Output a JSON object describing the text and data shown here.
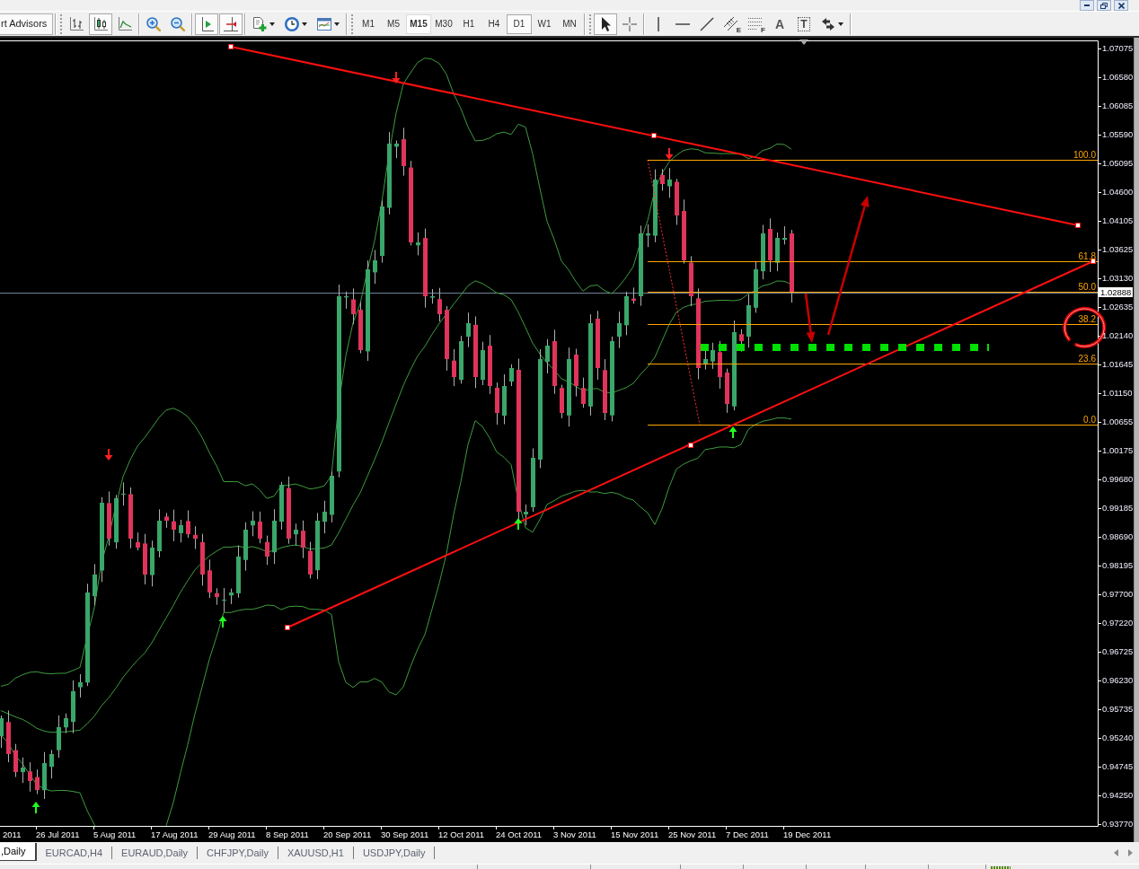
{
  "toolbar": {
    "experts_button": {
      "label": "rt Advisors"
    },
    "chart_tool_groups": [
      [
        {
          "kind": "bar-chart",
          "pressed": false
        },
        {
          "kind": "candlesticks",
          "pressed": true
        },
        {
          "kind": "line-chart",
          "pressed": false
        }
      ],
      [
        {
          "kind": "zoom-in",
          "pressed": false
        },
        {
          "kind": "zoom-out",
          "pressed": false
        }
      ],
      [
        {
          "kind": "chart-shift",
          "pressed": true
        },
        {
          "kind": "auto-scroll",
          "pressed": true
        }
      ],
      [
        {
          "kind": "new-indicator",
          "pressed": false,
          "dropdown": true
        },
        {
          "kind": "periods",
          "pressed": false,
          "dropdown": true
        },
        {
          "kind": "templates",
          "pressed": false,
          "dropdown": true
        }
      ]
    ],
    "timeframes": [
      {
        "label": "M1",
        "selected": false,
        "hovered": false
      },
      {
        "label": "M5",
        "selected": false,
        "hovered": false
      },
      {
        "label": "M15",
        "selected": false,
        "hovered": true
      },
      {
        "label": "M30",
        "selected": false,
        "hovered": false
      },
      {
        "label": "H1",
        "selected": false,
        "hovered": false
      },
      {
        "label": "H4",
        "selected": false,
        "hovered": false
      },
      {
        "label": "D1",
        "selected": true,
        "hovered": false
      },
      {
        "label": "W1",
        "selected": false,
        "hovered": false
      },
      {
        "label": "MN",
        "selected": false,
        "hovered": false
      }
    ],
    "drawing_tool_groups": [
      [
        {
          "kind": "cursor",
          "pressed": true
        },
        {
          "kind": "crosshair",
          "pressed": false
        }
      ],
      [
        {
          "kind": "vertical-line",
          "pressed": false
        },
        {
          "kind": "horizontal-line",
          "pressed": false
        },
        {
          "kind": "trend-line",
          "pressed": false
        },
        {
          "kind": "channel",
          "label": "E",
          "pressed": false
        },
        {
          "kind": "fibonacci",
          "label": "F",
          "pressed": false
        },
        {
          "kind": "text",
          "label": "A",
          "pressed": false
        },
        {
          "kind": "text-label",
          "label": "T",
          "pressed": false
        },
        {
          "kind": "arrows",
          "pressed": false,
          "dropdown": true
        }
      ]
    ]
  },
  "chart": {
    "price_axis": [
      "1.07075",
      "1.06580",
      "1.06085",
      "1.05590",
      "1.05095",
      "1.04600",
      "1.04105",
      "1.03625",
      "1.03130",
      "1.02635",
      "1.02140",
      "1.01645",
      "1.01150",
      "1.00655",
      "1.00175",
      "0.99680",
      "0.99185",
      "0.98690",
      "0.98195",
      "0.97700",
      "0.97220",
      "0.96725",
      "0.96230",
      "0.95735",
      "0.95240",
      "0.94745",
      "0.94250",
      "0.93770"
    ],
    "current_price": "1.02888",
    "time_axis": [
      "2011",
      "26 Jul 2011",
      "5 Aug 2011",
      "17 Aug 2011",
      "29 Aug 2011",
      "8 Sep 2011",
      "20 Sep 2011",
      "30 Sep 2011",
      "12 Oct 2011",
      "24 Oct 2011",
      "3 Nov 2011",
      "15 Nov 2011",
      "25 Nov 2011",
      "7 Dec 2011",
      "19 Dec 2011"
    ],
    "fibonacci_levels": [
      "100.0",
      "61.8",
      "50.0",
      "38.2",
      "23.6",
      "0.0"
    ]
  },
  "tabs": [
    {
      "label": ",Daily",
      "selected": true
    },
    {
      "label": "EURCAD,H4",
      "selected": false
    },
    {
      "label": "EURAUD,Daily",
      "selected": false
    },
    {
      "label": "CHFJPY,Daily",
      "selected": false
    },
    {
      "label": "XAUUSD,H1",
      "selected": false
    },
    {
      "label": "USDJPY,Daily",
      "selected": false
    }
  ]
}
